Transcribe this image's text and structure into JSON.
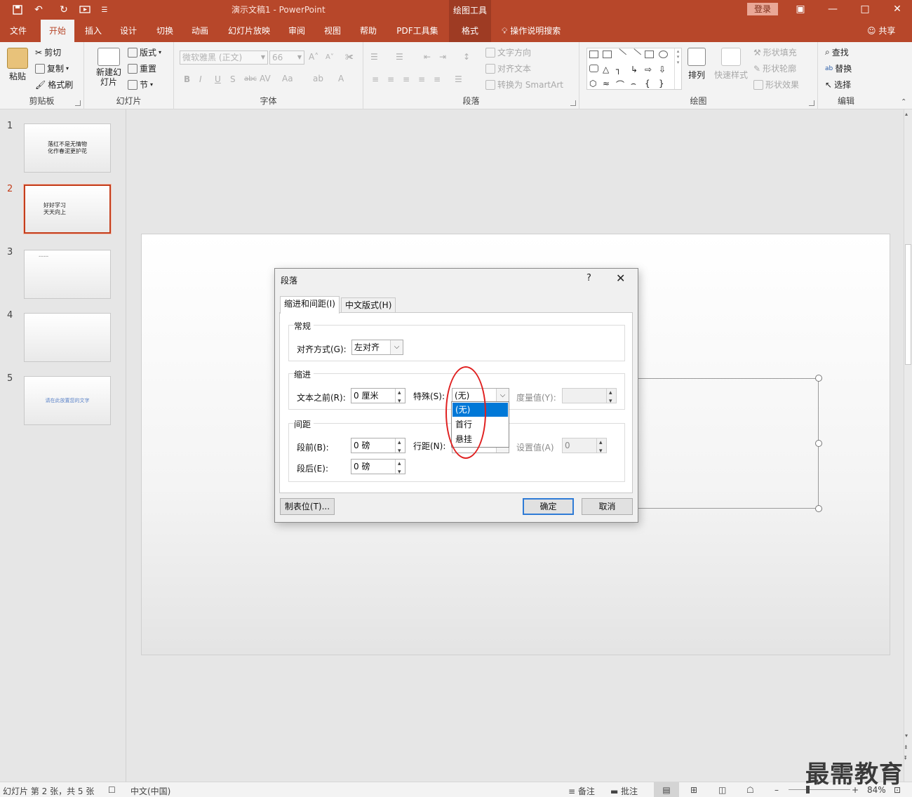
{
  "titlebar": {
    "doc_title": "演示文稿1  -  PowerPoint",
    "context_tab": "绘图工具",
    "login": "登录",
    "quick_access": [
      "save-icon",
      "undo-icon",
      "redo-icon",
      "start-from-beginning-icon",
      "customize-icon"
    ]
  },
  "tabs": [
    "文件",
    "开始",
    "插入",
    "设计",
    "切换",
    "动画",
    "幻灯片放映",
    "审阅",
    "视图",
    "帮助",
    "PDF工具集",
    "格式"
  ],
  "active_tab": "开始",
  "tell_me": "操作说明搜索",
  "share": "共享",
  "ribbon": {
    "clipboard": {
      "label": "剪贴板",
      "paste": "粘贴",
      "cut": "剪切",
      "copy": "复制",
      "format_painter": "格式刷"
    },
    "slides": {
      "label": "幻灯片",
      "new_slide": "新建幻灯片",
      "layout": "版式",
      "reset": "重置",
      "section": "节"
    },
    "font": {
      "label": "字体",
      "font_name": "微软雅黑 (正文)",
      "font_size": "66"
    },
    "paragraph": {
      "label": "段落",
      "text_direction": "文字方向",
      "align_text": "对齐文本",
      "convert_smartart": "转换为 SmartArt"
    },
    "drawing": {
      "label": "绘图",
      "arrange": "排列",
      "quick_styles": "快速样式",
      "shape_fill": "形状填充",
      "shape_outline": "形状轮廓",
      "shape_effects": "形状效果"
    },
    "editing": {
      "label": "编辑",
      "find": "查找",
      "replace": "替换",
      "select": "选择"
    }
  },
  "slides": [
    {
      "num": "1",
      "text": "落红不是无情物\n化作春泥更护花"
    },
    {
      "num": "2",
      "text": "好好学习\n天天向上"
    },
    {
      "num": "3",
      "text": "••••••"
    },
    {
      "num": "4",
      "text": ""
    },
    {
      "num": "5",
      "text": "请在此放置您的文字"
    }
  ],
  "selected_slide": 2,
  "status": {
    "slide_info": "幻灯片 第 2 张，共 5 张",
    "language": "中文(中国)",
    "notes": "备注",
    "comments": "批注",
    "zoom": "84%"
  },
  "watermark": "最需教育",
  "dialog": {
    "title": "段落",
    "help": "?",
    "close": "✕",
    "tabs": [
      "缩进和间距(I)",
      "中文版式(H)"
    ],
    "general": {
      "heading": "常规",
      "alignment_label": "对齐方式(G):",
      "alignment_value": "左对齐"
    },
    "indent": {
      "heading": "缩进",
      "before_text_label": "文本之前(R):",
      "before_text_value": "0 厘米",
      "special_label": "特殊(S):",
      "special_value": "(无)",
      "by_label": "度量值(Y):",
      "by_value": ""
    },
    "spacing": {
      "heading": "间距",
      "before_label": "段前(B):",
      "before_value": "0 磅",
      "after_label": "段后(E):",
      "after_value": "0 磅",
      "line_label": "行距(N):",
      "at_label": "设置值(A)",
      "at_value": "0"
    },
    "special_options": [
      "(无)",
      "首行",
      "悬挂"
    ],
    "tabs_button": "制表位(T)...",
    "ok": "确定",
    "cancel": "取消"
  }
}
